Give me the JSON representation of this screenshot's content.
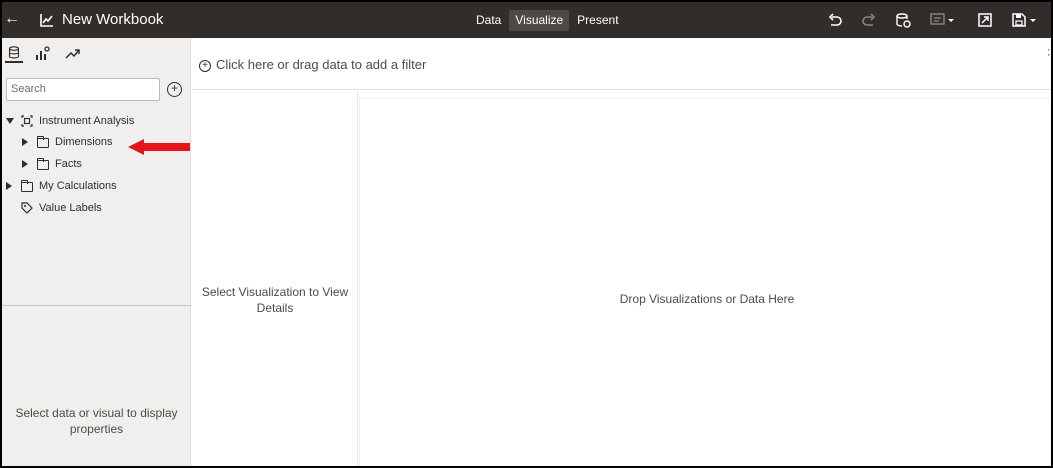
{
  "header": {
    "title": "New Workbook",
    "modes": [
      {
        "label": "Data",
        "active": false
      },
      {
        "label": "Visualize",
        "active": true
      },
      {
        "label": "Present",
        "active": false
      }
    ]
  },
  "toolbar_icons": [
    "undo-icon",
    "redo-icon",
    "data-refresh-icon",
    "comment-icon",
    "present-icon",
    "save-icon"
  ],
  "left_panel": {
    "tabs": [
      "data-icon",
      "grammar-icon",
      "analytics-icon"
    ],
    "search": {
      "placeholder": "Search",
      "value": ""
    },
    "tree": {
      "root": "Instrument Analysis",
      "dimensions": "Dimensions",
      "facts": "Facts",
      "calculations": "My Calculations",
      "value_labels": "Value Labels"
    },
    "properties_message": "Select data or visual to display properties"
  },
  "filter_bar": {
    "text": "Click here or drag data to add a filter"
  },
  "details": {
    "message": "Select Visualization to View Details"
  },
  "canvas": {
    "message": "Drop Visualizations or Data Here"
  },
  "colors": {
    "header_bg": "#312d2a",
    "panel_bg": "#f1efed",
    "active_mode_bg": "#4d4945",
    "annotation_arrow": "#e8131b"
  }
}
